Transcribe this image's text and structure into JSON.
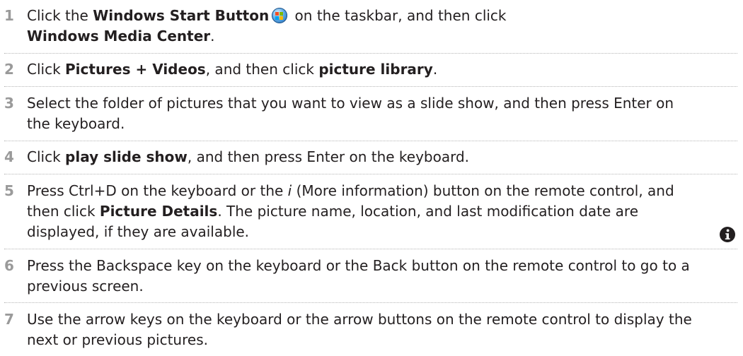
{
  "steps": [
    {
      "number": "1",
      "t1": "Click the ",
      "b1": "Windows Start Button",
      "t2": " on the taskbar, and then click ",
      "b2": "Windows Media Center",
      "t3": "."
    },
    {
      "number": "2",
      "t1": "Click ",
      "b1": "Pictures + Videos",
      "t2": ", and then click ",
      "b2": "picture library",
      "t3": "."
    },
    {
      "number": "3",
      "t1": "Select the folder of pictures that you want to view as a slide show, and then press Enter on the keyboard."
    },
    {
      "number": "4",
      "t1": "Click ",
      "b1": "play slide show",
      "t2": ", and then press Enter on the keyboard."
    },
    {
      "number": "5",
      "t1": "Press Ctrl+D on the keyboard or the ",
      "i1": "i",
      "t2": " (More information) button on the remote control, and then click ",
      "b1": "Picture Details",
      "t3": ". The picture name, location, and last modification date are displayed, if they are available."
    },
    {
      "number": "6",
      "t1": "Press the Backspace key on the keyboard or the Back button on the remote control to go to a previous screen."
    },
    {
      "number": "7",
      "t1": "Use the arrow keys on the keyboard or the arrow buttons on the remote control to display the next or previous pictures."
    }
  ],
  "icons": {
    "start_button": "windows-start-orb-icon",
    "info": "info-icon"
  }
}
